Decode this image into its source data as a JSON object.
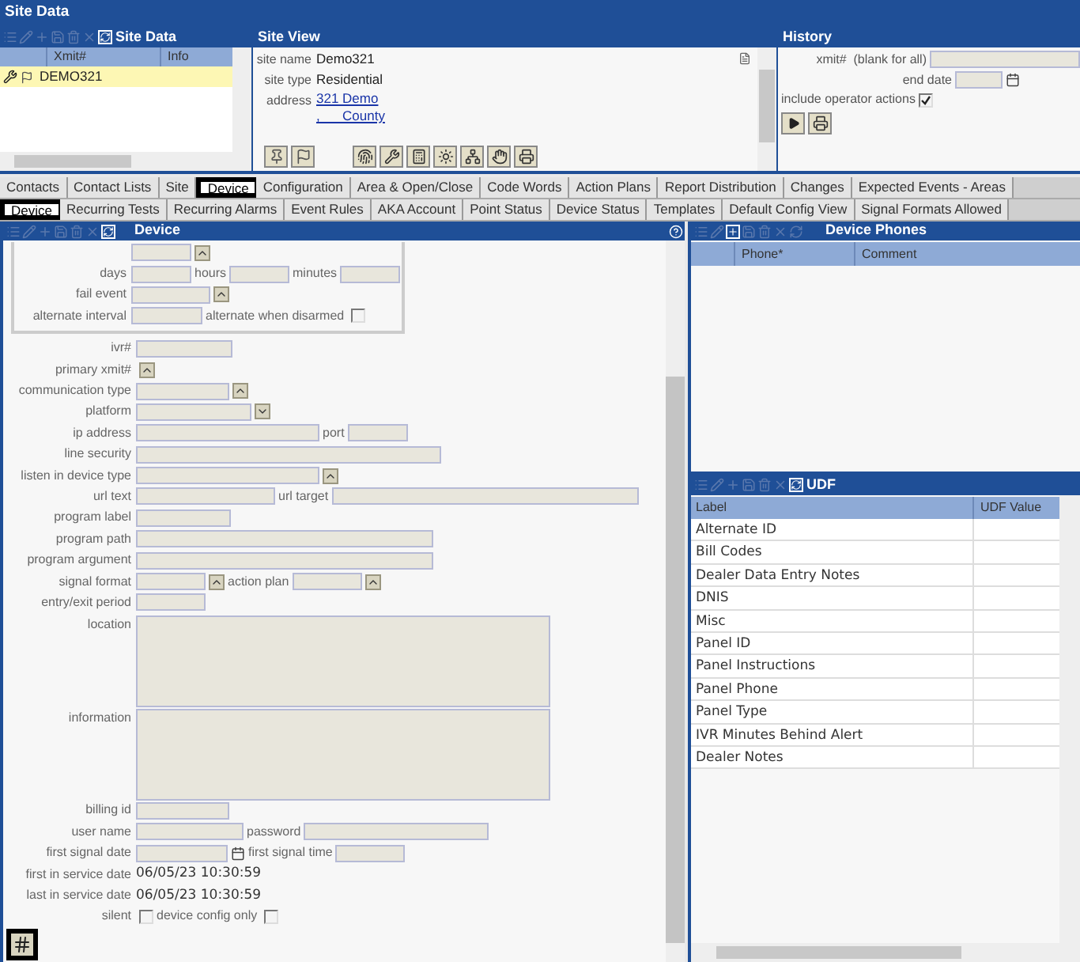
{
  "title": "Site Data",
  "site_data": {
    "title": "Site Data",
    "columns": [
      "Xmit#",
      "Info"
    ],
    "rows": [
      {
        "xmit": "DEMO321",
        "selected": true
      }
    ]
  },
  "site_view": {
    "title": "Site View",
    "fields": [
      {
        "kind": "text",
        "label": "site name",
        "value": "Demo321"
      },
      {
        "kind": "text",
        "label": "site type",
        "value": "Residential"
      },
      {
        "kind": "link",
        "label": "address",
        "lines": [
          "321 Demo",
          ",      County"
        ]
      }
    ]
  },
  "history": {
    "title": "History",
    "xmit_label": "xmit#  (blank for all)",
    "end_date_label": "end date",
    "operator_actions": {
      "label": "include operator actions",
      "checked": true
    }
  },
  "tabs": [
    {
      "label": "Contacts",
      "selected": false
    },
    {
      "label": "Contact Lists",
      "selected": false
    },
    {
      "label": "Site",
      "selected": false
    },
    {
      "label": "Device",
      "selected": true
    },
    {
      "label": "Configuration",
      "selected": false
    },
    {
      "label": "Area & Open/Close",
      "selected": false
    },
    {
      "label": "Code Words",
      "selected": false
    },
    {
      "label": "Action Plans",
      "selected": false
    },
    {
      "label": "Report Distribution",
      "selected": false
    },
    {
      "label": "Changes",
      "selected": false
    },
    {
      "label": "Expected Events - Areas",
      "selected": false
    }
  ],
  "subtabs": [
    {
      "label": "Device",
      "selected": true
    },
    {
      "label": "Recurring Tests",
      "selected": false
    },
    {
      "label": "Recurring Alarms",
      "selected": false
    },
    {
      "label": "Event Rules",
      "selected": false
    },
    {
      "label": "AKA Account",
      "selected": false
    },
    {
      "label": "Point Status",
      "selected": false
    },
    {
      "label": "Device Status",
      "selected": false
    },
    {
      "label": "Templates",
      "selected": false
    },
    {
      "label": "Default Config View",
      "selected": false
    },
    {
      "label": "Signal Formats Allowed",
      "selected": false
    }
  ],
  "device": {
    "title": "Device",
    "schedule": [
      {
        "items": [
          {
            "kind": "input"
          },
          {
            "kind": "spin"
          }
        ]
      },
      {
        "label": "days",
        "items": [
          {
            "kind": "input"
          },
          {
            "kind": "label",
            "text": "hours"
          },
          {
            "kind": "input"
          },
          {
            "kind": "label",
            "text": "minutes"
          },
          {
            "kind": "input"
          }
        ]
      },
      {
        "label": "fail event",
        "items": [
          {
            "kind": "input"
          },
          {
            "kind": "spin"
          }
        ]
      },
      {
        "label": "alternate interval",
        "items": [
          {
            "kind": "input"
          },
          {
            "kind": "label",
            "text": "alternate when disarmed"
          },
          {
            "kind": "check",
            "checked": false
          }
        ]
      }
    ],
    "rows": [
      {
        "label": "ivr#",
        "items": [
          {
            "kind": "input"
          }
        ]
      },
      {
        "label": "primary xmit#",
        "items": [
          {
            "kind": "spin"
          }
        ]
      },
      {
        "label": "communication type",
        "items": [
          {
            "kind": "input"
          },
          {
            "kind": "spin"
          }
        ]
      },
      {
        "label": "platform",
        "items": [
          {
            "kind": "input"
          },
          {
            "kind": "dropdown"
          }
        ]
      },
      {
        "label": "ip address",
        "items": [
          {
            "kind": "input"
          },
          {
            "kind": "label",
            "text": "port"
          },
          {
            "kind": "input"
          }
        ]
      },
      {
        "label": "line security",
        "items": [
          {
            "kind": "input"
          }
        ]
      },
      {
        "label": "listen in device type",
        "items": [
          {
            "kind": "input"
          },
          {
            "kind": "spin"
          }
        ]
      },
      {
        "label": "url text",
        "items": [
          {
            "kind": "input"
          },
          {
            "kind": "label",
            "text": "url target"
          },
          {
            "kind": "input"
          }
        ]
      },
      {
        "label": "program label",
        "items": [
          {
            "kind": "input"
          }
        ]
      },
      {
        "label": "program path",
        "items": [
          {
            "kind": "input"
          }
        ]
      },
      {
        "label": "program argument",
        "items": [
          {
            "kind": "input"
          }
        ]
      },
      {
        "label": "signal format",
        "items": [
          {
            "kind": "input"
          },
          {
            "kind": "spin"
          },
          {
            "kind": "label",
            "text": "action plan"
          },
          {
            "kind": "input"
          },
          {
            "kind": "spin"
          }
        ]
      },
      {
        "label": "entry/exit period",
        "items": [
          {
            "kind": "input"
          }
        ]
      },
      {
        "label": "location",
        "items": [
          {
            "kind": "textarea"
          }
        ]
      },
      {
        "label": "information",
        "items": [
          {
            "kind": "textarea"
          }
        ]
      },
      {
        "label": "billing id",
        "items": [
          {
            "kind": "input"
          }
        ]
      },
      {
        "label": "user name",
        "items": [
          {
            "kind": "input"
          },
          {
            "kind": "label",
            "text": "password"
          },
          {
            "kind": "input"
          }
        ]
      },
      {
        "label": "first signal date",
        "items": [
          {
            "kind": "input"
          },
          {
            "kind": "calendar"
          },
          {
            "kind": "label",
            "text": "first signal time"
          },
          {
            "kind": "input"
          }
        ]
      },
      {
        "label": "first in service date",
        "items": [
          {
            "kind": "text",
            "text": "06/05/23 10:30:59"
          }
        ]
      },
      {
        "label": "last in service date",
        "items": [
          {
            "kind": "text",
            "text": "06/05/23 10:30:59"
          }
        ]
      },
      {
        "label": "silent",
        "items": [
          {
            "kind": "check",
            "checked": false
          },
          {
            "kind": "label",
            "text": "device config only"
          },
          {
            "kind": "check",
            "checked": false
          }
        ]
      }
    ]
  },
  "device_phones": {
    "title": "Device Phones",
    "columns": [
      "Phone*",
      "Comment"
    ]
  },
  "udf": {
    "title": "UDF",
    "columns": [
      "Label",
      "UDF Value"
    ],
    "rows": [
      "Alternate ID",
      "Bill Codes",
      "Dealer Data Entry Notes",
      "DNIS",
      "Misc",
      "Panel ID",
      "Panel Instructions",
      "Panel Phone",
      "Panel Type",
      "IVR Minutes Behind Alert",
      "Dealer Notes"
    ]
  }
}
